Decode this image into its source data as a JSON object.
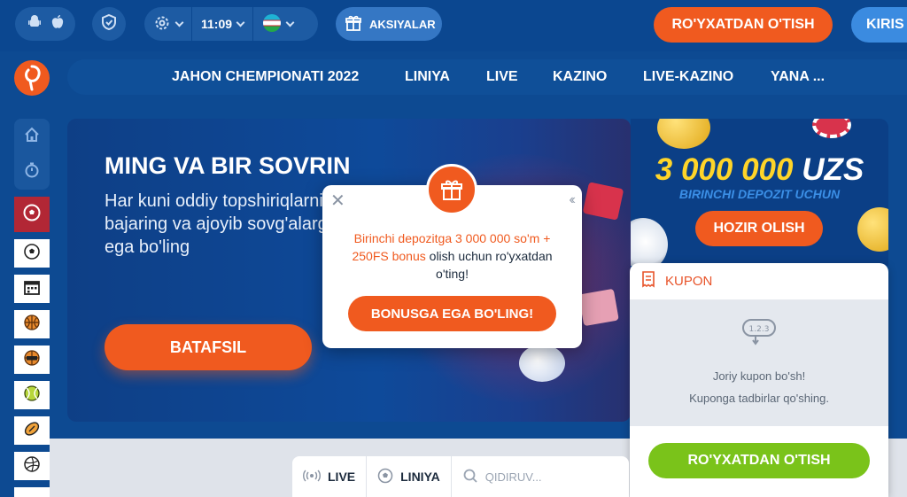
{
  "header": {
    "time": "11:09",
    "promotions_label": "AKSIYALAR",
    "register_label": "RO'YXATDAN O'TISH",
    "login_label": "KIRIS"
  },
  "nav": {
    "items": [
      "JAHON CHEMPIONATI 2022",
      "LINIYA",
      "LIVE",
      "KAZINO",
      "LIVE-KAZINO",
      "YANA ..."
    ]
  },
  "banner": {
    "title": "MING VA BIR SOVRIN",
    "text": "Har kuni oddiy topshiriqlarni bajaring va ajoyib sovg'alarga ega bo'ling",
    "button_label": "BATAFSIL"
  },
  "popup": {
    "highlight": "Birinchi depozitga 3 000 000 so'm + 250FS bonus",
    "text": " olish uchun ro'yxatdan o'ting!",
    "button_label": "BONUSGA EGA BO'LING!"
  },
  "promo": {
    "amount": "3 000 000",
    "currency": "UZS",
    "subtitle": "BIRINCHI DEPOZIT UCHUN",
    "button_label": "HOZIR OLISH"
  },
  "coupon": {
    "title": "KUPON",
    "empty_line1": "Joriy kupon bo'sh!",
    "empty_line2": "Kuponga tadbirlar qo'shing.",
    "register_label": "RO'YXATDAN O'TISH"
  },
  "tabs": {
    "live_label": "LIVE",
    "line_label": "LINIYA",
    "search_placeholder": "QIDIRUV..."
  },
  "colors": {
    "brand_orange": "#f05a1f",
    "header_blue": "#0b4790",
    "accent_green": "#7ac31a",
    "active_sport": "#b22735"
  }
}
